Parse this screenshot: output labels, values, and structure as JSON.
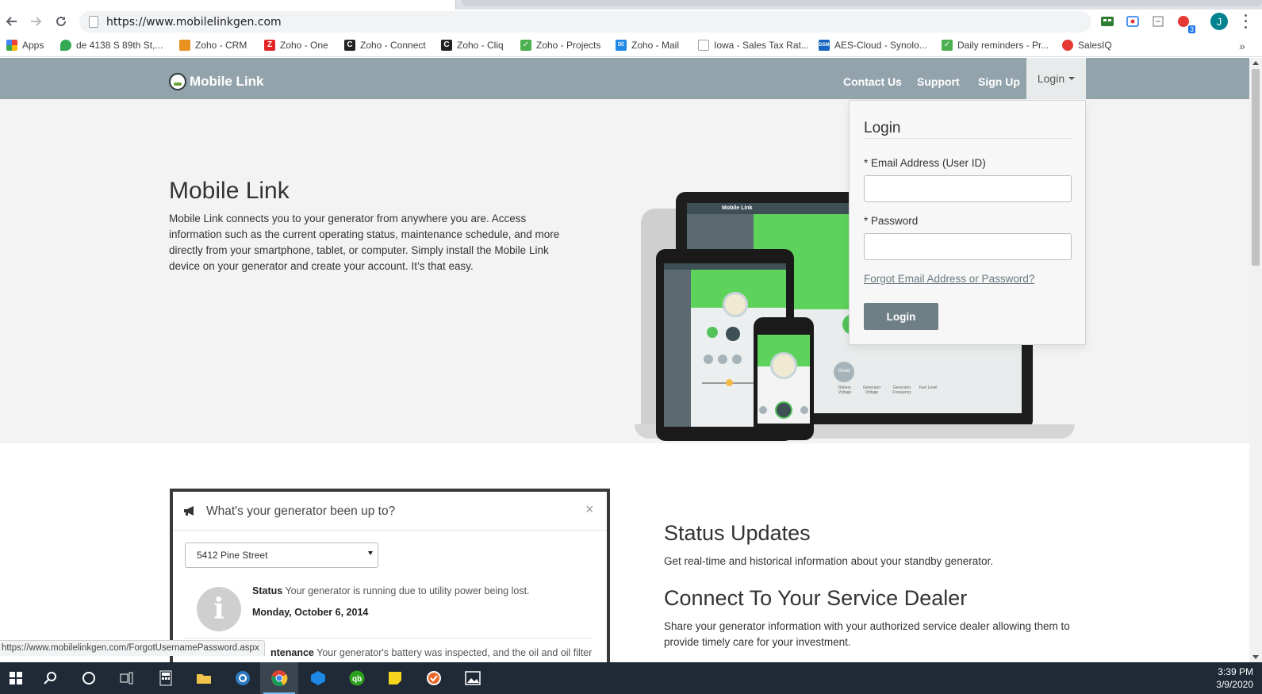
{
  "browser": {
    "url": "https://www.mobilelinkgen.com",
    "profile_initial": "J",
    "extension_badge": "3",
    "bookmarks": [
      {
        "label": "Apps",
        "icon": "apps-grid-icon",
        "color": "#ea4335"
      },
      {
        "label": "de 4138 S 89th St,...",
        "icon": "maps-pin-icon",
        "color": "#34a853"
      },
      {
        "label": "Zoho - CRM",
        "icon": "zoho-crm-icon",
        "color": "#e89220"
      },
      {
        "label": "Zoho - One",
        "icon": "zoho-one-icon",
        "color": "#e42527"
      },
      {
        "label": "Zoho - Connect",
        "icon": "zoho-connect-icon",
        "color": "#222222"
      },
      {
        "label": "Zoho - Cliq",
        "icon": "zoho-cliq-icon",
        "color": "#222222"
      },
      {
        "label": "Zoho - Projects",
        "icon": "zoho-projects-icon",
        "color": "#4caf50"
      },
      {
        "label": "Zoho - Mail",
        "icon": "zoho-mail-icon",
        "color": "#1e88e5"
      },
      {
        "label": "Iowa - Sales Tax Rat...",
        "icon": "page-icon",
        "color": "#9aa0a6"
      },
      {
        "label": "AES-Cloud - Synolo...",
        "icon": "dsm-icon",
        "color": "#1565c0"
      },
      {
        "label": "Daily reminders - Pr...",
        "icon": "check-icon",
        "color": "#4caf50"
      },
      {
        "label": "SalesIQ",
        "icon": "salesiq-icon",
        "color": "#e53935"
      }
    ],
    "status_url": "https://www.mobilelinkgen.com/ForgotUsernamePassword.aspx"
  },
  "site": {
    "brand": "Mobile Link",
    "nav": {
      "contact": "Contact Us",
      "support": "Support",
      "signup": "Sign Up",
      "login": "Login"
    },
    "hero": {
      "title": "Mobile Link",
      "text": "Mobile Link connects you to your generator from anywhere you are. Access information such as the current operating status, maintenance schedule, and more directly from your smartphone, tablet, or computer. Simply install the Mobile Link device on your generator and create your account. It’s that easy."
    },
    "login_panel": {
      "title": "Login",
      "email_label": "* Email Address (User ID)",
      "email_value": "",
      "password_label": "* Password",
      "password_value": "",
      "forgot": "Forgot Email Address or Password?",
      "button": "Login"
    },
    "device_screens": {
      "laptop_brand": "Mobile Link",
      "laptop_labels": [
        "Battery Voltage",
        "Generator Voltage",
        "Generator Frequency",
        "Fuel Level"
      ],
      "good_label": "Good"
    },
    "modal": {
      "title": "What's your generator been up to?",
      "close": "×",
      "select_value": "5412 Pine Street",
      "status_label": "Status",
      "status_text": "Your generator is running due to utility power being lost.",
      "status_date": "Monday, October 6, 2014",
      "maint_label": "ntenance",
      "maint_text": "Your generator's battery was inspected, and the oil and oil filter"
    },
    "sections": [
      {
        "title": "Status Updates",
        "text": "Get real-time and historical information about your standby generator."
      },
      {
        "title": "Connect To Your Service Dealer",
        "text": "Share your generator information with your authorized service dealer allowing them to provide timely care for your investment."
      }
    ]
  },
  "taskbar": {
    "time": "3:39 PM",
    "date": "3/9/2020",
    "apps": [
      "start-icon",
      "search-icon",
      "cortana-icon",
      "task-view-icon",
      "calculator-icon",
      "file-explorer-icon",
      "outlook-icon",
      "chrome-icon",
      "app-icon",
      "quickbooks-icon",
      "sticky-notes-icon",
      "todo-icon",
      "photos-icon"
    ]
  },
  "colors": {
    "site_nav": "#93a3ab",
    "hero_bg": "#f3f3f3",
    "login_button": "#6f7f86",
    "device_green": "#5ed35b",
    "taskbar": "#1f2a36"
  }
}
